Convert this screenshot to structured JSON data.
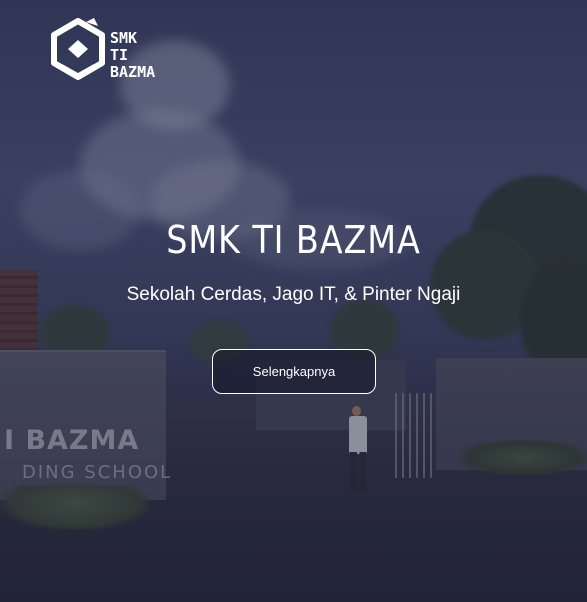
{
  "brand": {
    "logo_line1": "SMK TI",
    "logo_line2": "BAZMA"
  },
  "hero": {
    "title": "SMK TI BAZMA",
    "subtitle": "Sekolah Cerdas, Jago IT, & Pinter Ngaji",
    "cta_label": "Selengkapnya",
    "background_sign_line1": "I BAZMA",
    "background_sign_line2": "DING SCHOOL"
  },
  "colors": {
    "text": "#ffffff",
    "overlay": "#1e2037"
  }
}
